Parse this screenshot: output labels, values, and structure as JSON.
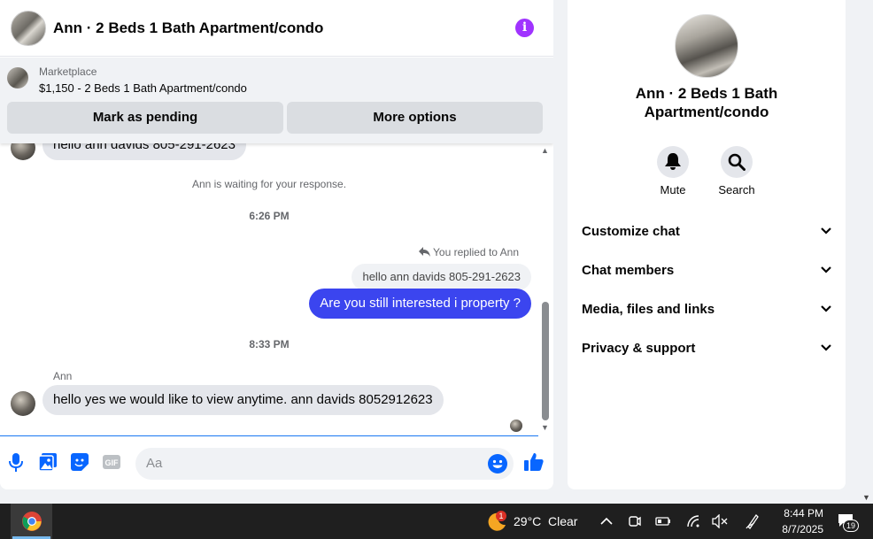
{
  "header": {
    "title": "Ann · 2 Beds 1 Bath Apartment/condo",
    "info_icon": "info-icon"
  },
  "marketplace": {
    "label": "Marketplace",
    "listing": "$1,150 - 2 Beds 1 Bath Apartment/condo",
    "pending_button": "Mark as pending",
    "options_button": "More options"
  },
  "messages": {
    "first_incoming": "hello ann davids 805-291-2623",
    "waiting_notice": "Ann is waiting for your response.",
    "time1": "6:26 PM",
    "replied_label": "You replied to Ann",
    "quoted_reply": "hello ann davids 805-291-2623",
    "outgoing": "Are you still interested i property ?",
    "time2": "8:33 PM",
    "sender_name": "Ann",
    "last_incoming": "hello yes we would like to view anytime. ann davids 8052912623"
  },
  "composer": {
    "placeholder": "Aa"
  },
  "side": {
    "title": "Ann · 2 Beds 1 Bath Apartment/condo",
    "mute_label": "Mute",
    "search_label": "Search",
    "rows": [
      "Customize chat",
      "Chat members",
      "Media, files and links",
      "Privacy & support"
    ]
  },
  "taskbar": {
    "temperature": "29°C",
    "weather": "Clear",
    "weather_badge": "1",
    "time": "8:44 PM",
    "date": "8/7/2025",
    "notifications": "19"
  },
  "colors": {
    "accent": "#3b45ef",
    "info": "#a033ff",
    "messenger_blue": "#0866ff"
  }
}
